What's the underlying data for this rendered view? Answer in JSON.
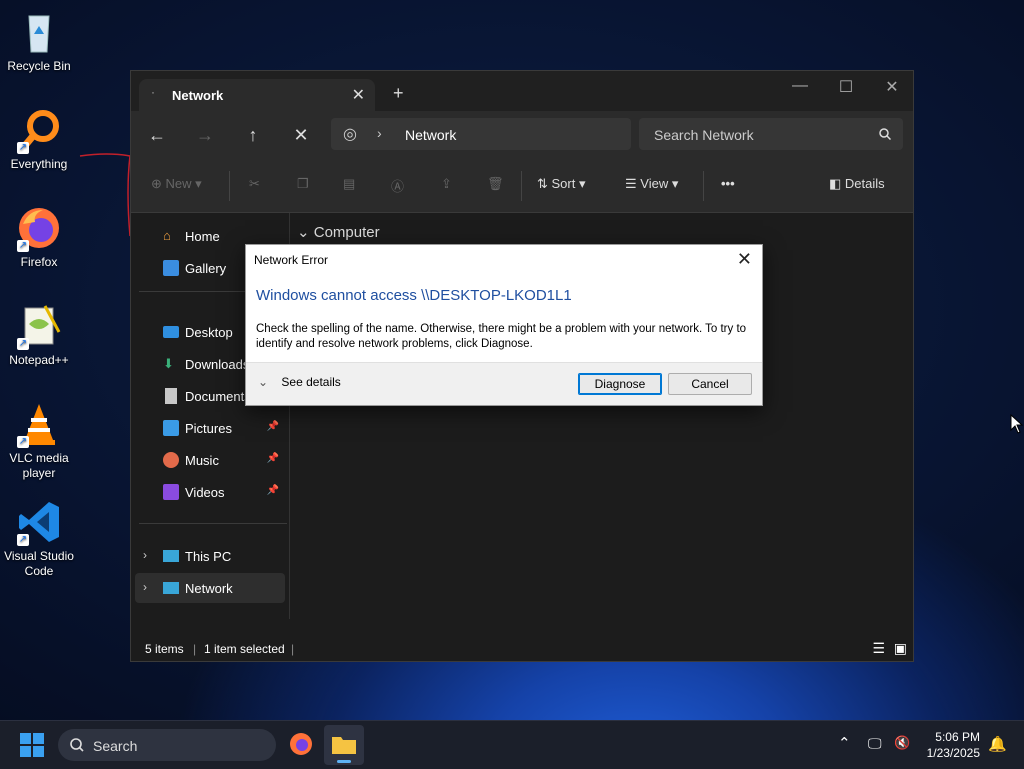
{
  "desktop": {
    "icons": [
      {
        "label": "Recycle Bin"
      },
      {
        "label": "Everything"
      },
      {
        "label": "Firefox"
      },
      {
        "label": "Notepad++"
      },
      {
        "label": "VLC media player"
      },
      {
        "label": "Visual Studio Code"
      }
    ]
  },
  "explorer": {
    "tab_title": "Network",
    "tab_close": "✕",
    "new_tab": "+",
    "address": "Network",
    "search_placeholder": "Search Network",
    "toolbar": {
      "new": "New",
      "sort": "Sort",
      "view": "View",
      "more": "•••",
      "details": "Details"
    },
    "nav": {
      "home": "Home",
      "gallery": "Gallery",
      "desktop": "Desktop",
      "downloads": "Downloads",
      "documents": "Documents",
      "pictures": "Pictures",
      "music": "Music",
      "videos": "Videos",
      "this_pc": "This PC",
      "network": "Network"
    },
    "content_header": "Computer",
    "status": {
      "items": "5 items",
      "selected": "1 item selected"
    }
  },
  "dialog": {
    "title": "Network Error",
    "heading": "Windows cannot access \\\\DESKTOP-LKOD1L1",
    "message": "Check the spelling of the name. Otherwise, there might be a problem with your network. To try to identify and resolve network problems, click Diagnose.",
    "see_details": "See details",
    "diagnose": "Diagnose",
    "cancel": "Cancel"
  },
  "taskbar": {
    "search_placeholder": "Search",
    "time": "5:06 PM",
    "date": "1/23/2025"
  },
  "colors": {
    "accent": "#0078d4",
    "dialog_heading": "#1f4fa0",
    "taskbar": "#1b1f2a"
  }
}
